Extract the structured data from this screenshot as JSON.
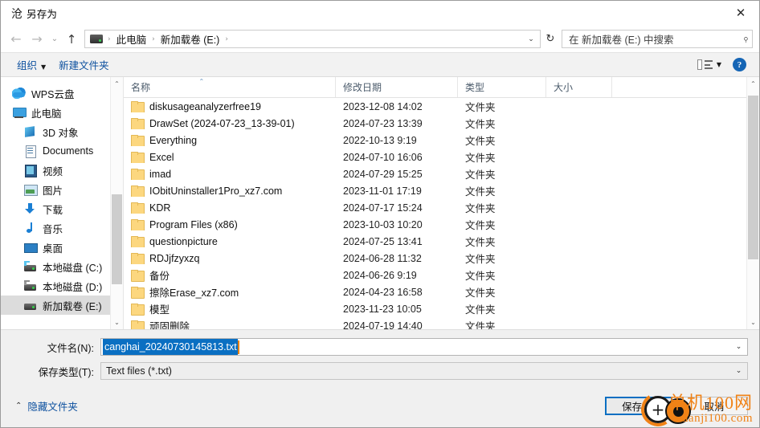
{
  "window": {
    "title": "另存为",
    "title_icon": "沧",
    "close_label": "✕"
  },
  "nav": {
    "back_icon": "←",
    "forward_icon": "→",
    "recent_icon": "⌄",
    "up_icon": "↑",
    "refresh_icon": "↻",
    "dropdown_icon": "⌄",
    "breadcrumb": [
      {
        "label": "此电脑",
        "sep": "›"
      },
      {
        "label": "新加载卷 (E:)",
        "sep": "›"
      }
    ],
    "breadcrumb_lead_sep": "›"
  },
  "search": {
    "placeholder": "在 新加载卷 (E:) 中搜索",
    "icon": "search-icon",
    "glyph": "⌕"
  },
  "toolbar": {
    "organize_label": "组织",
    "organize_caret": "▼",
    "new_folder_label": "新建文件夹",
    "view_caret": "▼",
    "help_label": "?"
  },
  "sidebar": {
    "items": [
      {
        "label": "WPS云盘",
        "icon": "cloud-icon",
        "indent": false,
        "selected": false
      },
      {
        "label": "此电脑",
        "icon": "this-pc-icon",
        "indent": false,
        "selected": false
      },
      {
        "label": "3D 对象",
        "icon": "3d-objects-icon",
        "indent": true,
        "selected": false
      },
      {
        "label": "Documents",
        "icon": "documents-icon",
        "indent": true,
        "selected": false
      },
      {
        "label": "视频",
        "icon": "videos-icon",
        "indent": true,
        "selected": false
      },
      {
        "label": "图片",
        "icon": "pictures-icon",
        "indent": true,
        "selected": false
      },
      {
        "label": "下载",
        "icon": "downloads-icon",
        "indent": true,
        "selected": false
      },
      {
        "label": "音乐",
        "icon": "music-icon",
        "indent": true,
        "selected": false
      },
      {
        "label": "桌面",
        "icon": "desktop-icon",
        "indent": true,
        "selected": false
      },
      {
        "label": "本地磁盘 (C:)",
        "icon": "disk-c-icon",
        "indent": true,
        "selected": false
      },
      {
        "label": "本地磁盘 (D:)",
        "icon": "disk-d-icon",
        "indent": true,
        "selected": false
      },
      {
        "label": "新加载卷 (E:)",
        "icon": "disk-e-icon",
        "indent": true,
        "selected": true
      }
    ],
    "scroll_up": "⌃",
    "scroll_down": "⌄"
  },
  "filelist": {
    "columns": [
      {
        "key": "name",
        "label": "名称",
        "sorted": true,
        "sort_glyph": "⌃"
      },
      {
        "key": "date",
        "label": "修改日期",
        "sorted": false
      },
      {
        "key": "type",
        "label": "类型",
        "sorted": false
      },
      {
        "key": "size",
        "label": "大小",
        "sorted": false
      }
    ],
    "rows": [
      {
        "name": "diskusageanalyzerfree19",
        "date": "2023-12-08 14:02",
        "type": "文件夹",
        "size": ""
      },
      {
        "name": "DrawSet (2024-07-23_13-39-01)",
        "date": "2024-07-23 13:39",
        "type": "文件夹",
        "size": ""
      },
      {
        "name": "Everything",
        "date": "2022-10-13 9:19",
        "type": "文件夹",
        "size": ""
      },
      {
        "name": "Excel",
        "date": "2024-07-10 16:06",
        "type": "文件夹",
        "size": ""
      },
      {
        "name": "imad",
        "date": "2024-07-29 15:25",
        "type": "文件夹",
        "size": ""
      },
      {
        "name": "IObitUninstaller1Pro_xz7.com",
        "date": "2023-11-01 17:19",
        "type": "文件夹",
        "size": ""
      },
      {
        "name": "KDR",
        "date": "2024-07-17 15:24",
        "type": "文件夹",
        "size": ""
      },
      {
        "name": "Program Files (x86)",
        "date": "2023-10-03 10:20",
        "type": "文件夹",
        "size": ""
      },
      {
        "name": "questionpicture",
        "date": "2024-07-25 13:41",
        "type": "文件夹",
        "size": ""
      },
      {
        "name": "RDJjfzyxzq",
        "date": "2024-06-28 11:32",
        "type": "文件夹",
        "size": ""
      },
      {
        "name": "备份",
        "date": "2024-06-26 9:19",
        "type": "文件夹",
        "size": ""
      },
      {
        "name": "擦除Erase_xz7.com",
        "date": "2024-04-23 16:58",
        "type": "文件夹",
        "size": ""
      },
      {
        "name": "模型",
        "date": "2023-11-23 10:05",
        "type": "文件夹",
        "size": ""
      },
      {
        "name": "顽固删除",
        "date": "2024-07-19 14:40",
        "type": "文件夹",
        "size": ""
      }
    ],
    "scroll_up": "⌃",
    "scroll_down": "⌄"
  },
  "form": {
    "filename_label": "文件名(N):",
    "filename_value": "canghai_20240730145813.txt",
    "filename_dropdown": "⌄",
    "filetype_label": "保存类型(T):",
    "filetype_value": "Text files (*.txt)",
    "filetype_dropdown": "⌄"
  },
  "footer": {
    "hide_folders_label": "隐藏文件夹",
    "hide_folders_chevron": "⌃",
    "save_label": "保存(S)",
    "cancel_label": "取消"
  },
  "overlay": {
    "cursor_plus": "+",
    "watermark_line1": "单机100网",
    "watermark_line2": "danji100.com"
  },
  "colors": {
    "accent": "#0a6fc2",
    "link": "#0b4f9e",
    "selection": "#0a6fc2",
    "caret": "#e8820c",
    "watermark": "#f08216",
    "folder": "#fcd77f"
  }
}
